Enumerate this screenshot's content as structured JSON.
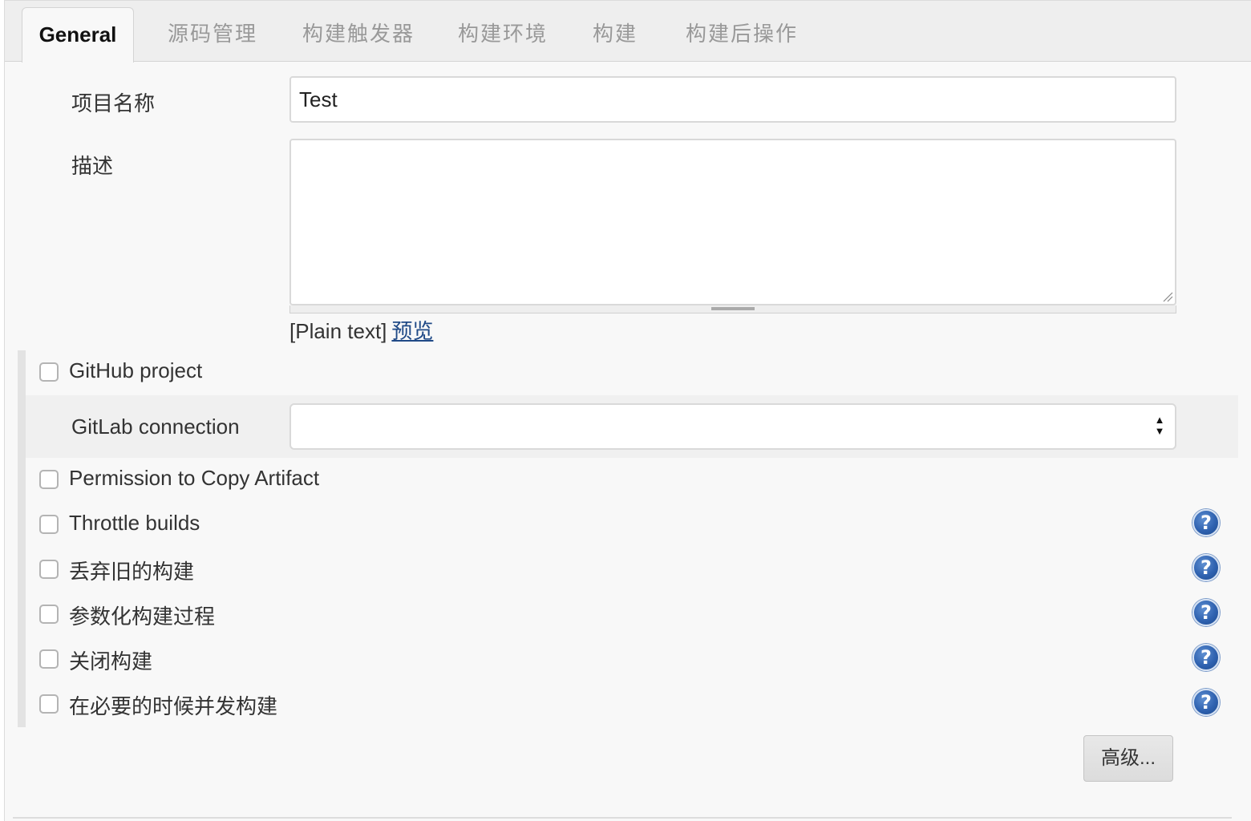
{
  "tabs": [
    {
      "label": "General",
      "active": true
    },
    {
      "label": "源码管理"
    },
    {
      "label": "构建触发器"
    },
    {
      "label": "构建环境"
    },
    {
      "label": "构建"
    },
    {
      "label": "构建后操作"
    }
  ],
  "project_name": {
    "label": "项目名称",
    "value": "Test"
  },
  "description": {
    "label": "描述",
    "value": "",
    "format_text": "[Plain text]",
    "preview_link": "预览"
  },
  "options": {
    "github_project": "GitHub project",
    "gitlab_connection": {
      "label": "GitLab connection",
      "selected": ""
    },
    "permission_copy_artifact": "Permission to Copy Artifact",
    "throttle_builds": "Throttle builds",
    "discard_old_builds": "丢弃旧的构建",
    "parameterized": "参数化构建过程",
    "disable_build": "关闭构建",
    "concurrent_builds": "在必要的时候并发构建"
  },
  "advanced_button": "高级...",
  "help_glyph": "?",
  "colors": {
    "link": "#204a87",
    "help_icon": "#2f62b0"
  }
}
